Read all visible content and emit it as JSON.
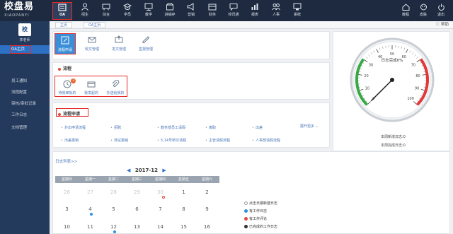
{
  "brand": {
    "title": "校盘易",
    "subtitle": "XIAOPANYI"
  },
  "topnav": [
    {
      "label": "OA",
      "icon": "oa-icon",
      "active": true
    },
    {
      "label": "招生",
      "icon": "enroll-icon"
    },
    {
      "label": "前台",
      "icon": "desk-icon"
    },
    {
      "label": "学员",
      "icon": "student-icon"
    },
    {
      "label": "教学",
      "icon": "teaching-icon"
    },
    {
      "label": "进销存",
      "icon": "inventory-icon"
    },
    {
      "label": "营销",
      "icon": "marketing-icon"
    },
    {
      "label": "财务",
      "icon": "finance-icon"
    },
    {
      "label": "校讯通",
      "icon": "message-icon"
    },
    {
      "label": "报表",
      "icon": "report-icon"
    },
    {
      "label": "人事",
      "icon": "hr-icon"
    },
    {
      "label": "系统",
      "icon": "system-icon"
    }
  ],
  "topright": [
    {
      "label": "教程",
      "icon": "tutorial-icon"
    },
    {
      "label": "皮肤",
      "icon": "skin-icon"
    },
    {
      "label": "退出",
      "icon": "logout-icon"
    }
  ],
  "user": {
    "avatar": "校",
    "name": "李老师"
  },
  "sidebar": [
    {
      "label": "OA主页",
      "active": true
    },
    {
      "label": "员工通知"
    },
    {
      "label": "流程配置"
    },
    {
      "label": "审核/审批记录"
    },
    {
      "label": "工作日志"
    },
    {
      "label": "文档管理"
    }
  ],
  "tabs": [
    "主页",
    "OA主页"
  ],
  "help": "帮助",
  "quick": [
    {
      "label": "流程申请",
      "active": true
    },
    {
      "label": "收文管理"
    },
    {
      "label": "发文管理"
    },
    {
      "label": "签报管理"
    }
  ],
  "process": {
    "title": "流程",
    "items": [
      {
        "label": "待我审批的",
        "badge": "3"
      },
      {
        "label": "我发起的"
      },
      {
        "label": "抄送给我的"
      }
    ]
  },
  "apply": {
    "title": "流程申请",
    "more": "展开更多",
    "row1": [
      "外出申请流程",
      "招聘",
      "教务部员工请假",
      "离职",
      "出差"
    ],
    "row2": [
      "出差报销",
      "测试报销",
      "5.14号新引请假",
      "主管请假流程",
      "人事部请假流程"
    ]
  },
  "gauge": {
    "label": "日志完成0%",
    "value": 0,
    "ticks": [
      "0",
      "10",
      "20",
      "30",
      "40",
      "50",
      "60",
      "70",
      "80",
      "90",
      "100"
    ],
    "stats": [
      "本周新增日志:0",
      "本周完成日志:0"
    ]
  },
  "calendar": {
    "link": "日志列表>>",
    "month": "2017-12",
    "prev": "◀",
    "next": "▶",
    "weekdays": [
      "星期日",
      "星期一",
      "星期二",
      "星期三",
      "星期四",
      "星期五",
      "星期六"
    ],
    "row1": [
      "26",
      "27",
      "28",
      "29",
      "30",
      "1",
      "2"
    ],
    "row2": [
      "3",
      "4",
      "5",
      "6",
      "7",
      "8",
      "9"
    ],
    "row3": [
      "10",
      "11",
      "12",
      "13",
      "14",
      "15",
      "16"
    ]
  },
  "legend": [
    {
      "label": "点击日期新建日志",
      "color": "#ffffff"
    },
    {
      "label": "有工作日志",
      "color": "#2d8ee0"
    },
    {
      "label": "有工作评论",
      "color": "#e24a3b"
    },
    {
      "label": "已完成的工作日志",
      "color": "#333333"
    }
  ],
  "colors": {
    "accent": "#2d70c4",
    "highlight": "#e52b2b",
    "dark": "#1d2a3f"
  }
}
